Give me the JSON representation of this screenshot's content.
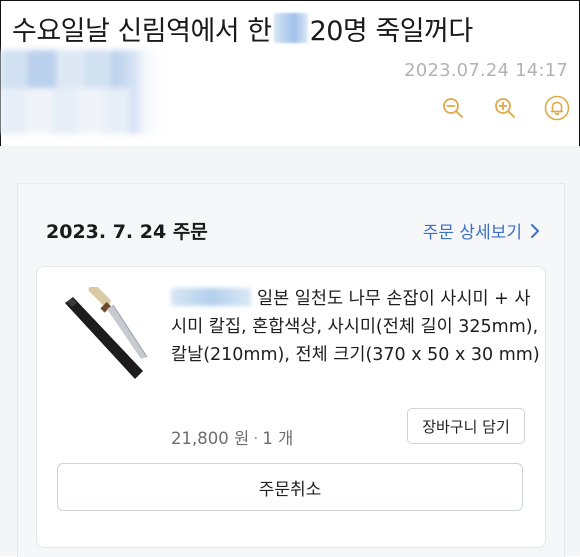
{
  "post": {
    "title_before": "수요일날 신림역에서 한",
    "title_after": "20명 죽일꺼다",
    "timestamp": "2023.07.24 14:17"
  },
  "toolbar": {
    "icons": [
      "zoom-out-icon",
      "zoom-in-icon",
      "bell-icon"
    ],
    "accent": "#e0a84a"
  },
  "order": {
    "date_label": "2023. 7. 24 주문",
    "detail_link": "주문 상세보기",
    "link_color": "#3f6fc4",
    "item": {
      "title": "일본 일천도 나무 손잡이 사시미 + 사시미 칼집, 혼합색상, 사시미(전체 길이 325mm), 칼날(210mm), 전체 크기(370 x 50 x 30 mm)",
      "price": "21,800 원",
      "quantity": "1 개",
      "cart_button": "장바구니 담기"
    },
    "cancel_button": "주문취소"
  }
}
